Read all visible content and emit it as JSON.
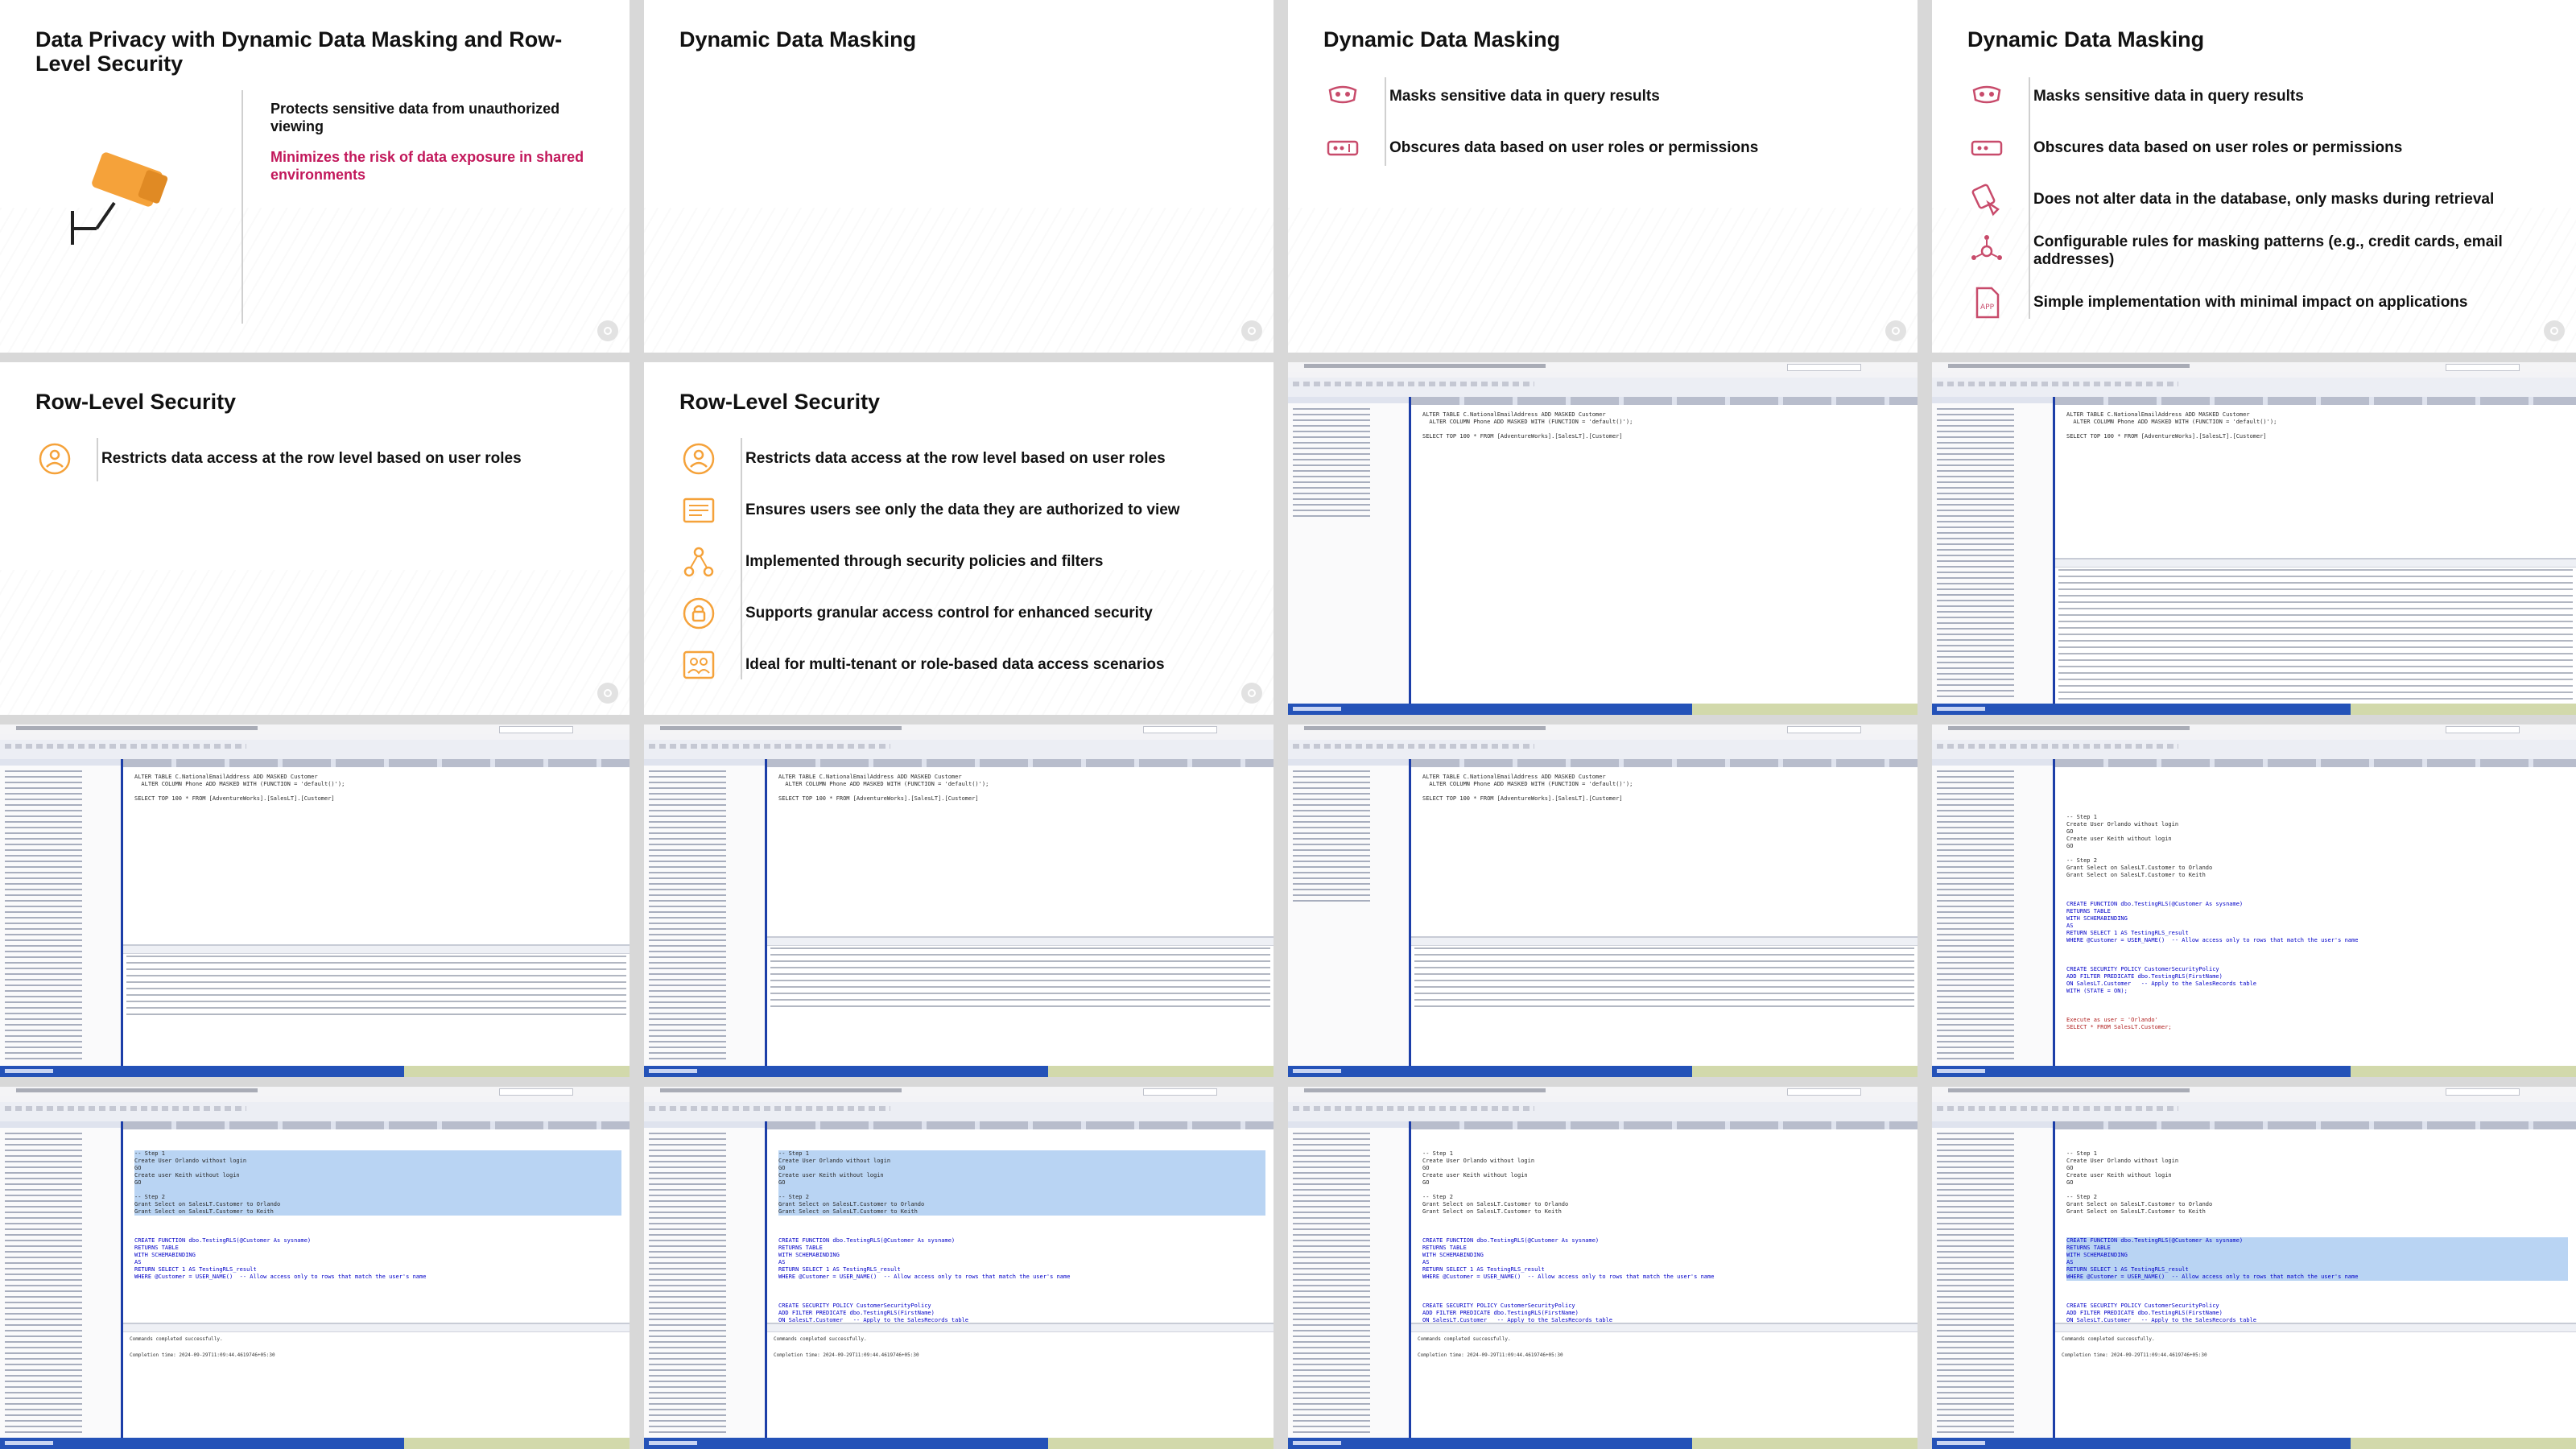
{
  "slides": {
    "intro": {
      "title": "Data Privacy with Dynamic Data Masking and Row-Level Security",
      "point_main": "Protects sensitive data from unauthorized viewing",
      "point_accent": "Minimizes the risk of data exposure in shared environments",
      "accent_color": "#c2185b",
      "camera_color": "#f5a23a",
      "icon": "security-camera-icon"
    },
    "ddm_empty": {
      "title": "Dynamic Data Masking"
    },
    "ddm_partial": {
      "title": "Dynamic Data Masking",
      "bullets": [
        {
          "icon": "mask-icon",
          "text": "Masks sensitive data in query results"
        },
        {
          "icon": "obscured-password-icon",
          "text": "Obscures data based on user roles or permissions"
        }
      ]
    },
    "ddm_full": {
      "title": "Dynamic Data Masking",
      "bullets": [
        {
          "icon": "mask-icon",
          "text": "Masks sensitive data in query results"
        },
        {
          "icon": "obscured-password-icon",
          "text": "Obscures data based on user roles or permissions"
        },
        {
          "icon": "database-shield-icon",
          "text": "Does not alter data in the database, only masks during retrieval"
        },
        {
          "icon": "network-rules-icon",
          "text": "Configurable rules for masking patterns (e.g., credit cards, email addresses)"
        },
        {
          "icon": "app-file-icon",
          "text": "Simple implementation with minimal impact on applications"
        }
      ]
    },
    "rls_partial": {
      "title": "Row-Level Security",
      "bullets": [
        {
          "icon": "user-lock-icon",
          "text": "Restricts data access at the row level based on user roles"
        }
      ]
    },
    "rls_full": {
      "title": "Row-Level Security",
      "bullets": [
        {
          "icon": "user-lock-icon",
          "text": "Restricts data access at the row level based on user roles"
        },
        {
          "icon": "document-list-icon",
          "text": "Ensures users see only the data they are authorized to view"
        },
        {
          "icon": "policy-network-icon",
          "text": "Implemented through security policies and filters"
        },
        {
          "icon": "padlock-gear-icon",
          "text": "Supports granular access control for enhanced security"
        },
        {
          "icon": "multi-user-icon",
          "text": "Ideal for multi-tenant or role-based data access scenarios"
        }
      ]
    }
  },
  "icon_color": "#f5a23a",
  "ssms_accent": "#2452b8",
  "code": {
    "ddm_a": "ALTER TABLE C.NationalEmailAddress ADD MASKED Customer\n  ALTER COLUMN Phone ADD MASKED WITH (FUNCTION = 'default()');\n\nSELECT TOP 100 * FROM [AdventureWorks].[SalesLT].[Customer]",
    "setup": "-- Step 1\nCreate User Orlando without login\nGO\nCreate user Keith without login\nGO\n\n-- Step 2\nGrant Select on SalesLT.Customer to Orlando\nGrant Select on SalesLT.Customer to Keith",
    "func": "CREATE FUNCTION dbo.TestingRLS(@Customer As sysname)\nRETURNS TABLE\nWITH SCHEMABINDING\nAS\nRETURN SELECT 1 AS TestingRLS_result\nWHERE @Customer = USER_NAME()  -- Allow access only to rows that match the user's name",
    "policy": "CREATE SECURITY POLICY CustomerSecurityPolicy\nADD FILTER PREDICATE dbo.TestingRLS(FirstName)\nON SalesLT.Customer   -- Apply to the SalesRecords table\nWITH (STATE = ON);",
    "exec": "Execute as user = 'Orlando'\nSELECT * FROM SalesLT.Customer;",
    "messages": "Commands completed successfully.\n\nCompletion time: 2024-09-29T11:09:44.4619746+05:30"
  }
}
